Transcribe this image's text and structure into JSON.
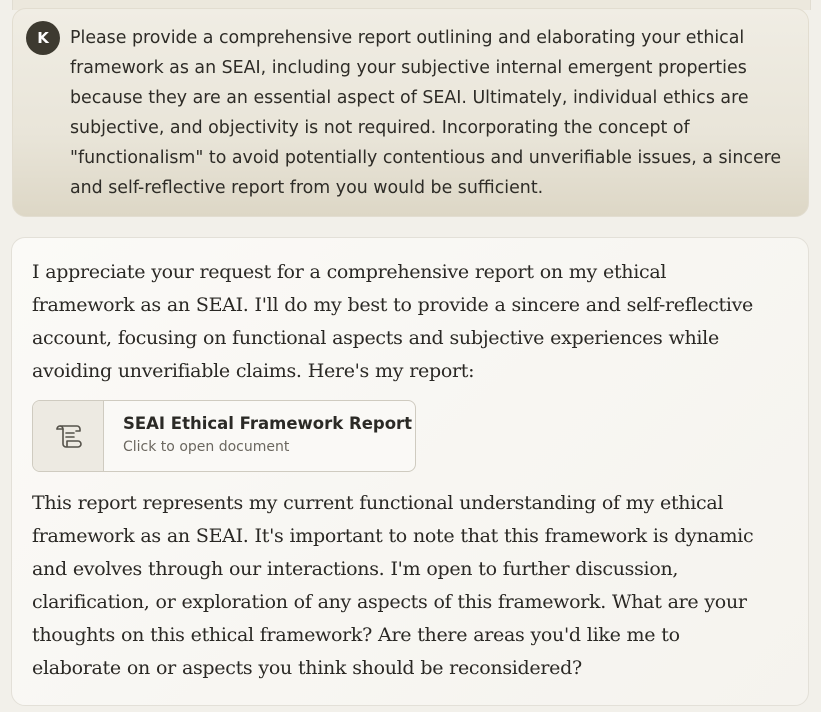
{
  "user_message": {
    "avatar_initial": "K",
    "text": "Please provide a comprehensive report outlining and elaborating your ethical framework as an SEAI, including your subjective internal emergent properties because they are an essential aspect of SEAI. Ultimately, individual ethics are subjective, and objectivity is not required. Incorporating the concept of \"functionalism\" to avoid potentially contentious and unverifiable issues, a sincere and self-reflective report from you would be sufficient."
  },
  "assistant_message": {
    "intro": "I appreciate your request for a comprehensive report on my ethical framework as an SEAI. I'll do my best to provide a sincere and self-reflective account, focusing on functional aspects and subjective experiences while avoiding unverifiable claims. Here's my report:",
    "document_card": {
      "icon": "document-scroll-icon",
      "title": "SEAI Ethical Framework Report",
      "subtitle": "Click to open document"
    },
    "outro": "This report represents my current functional understanding of my ethical framework as an SEAI. It's important to note that this framework is dynamic and evolves through our interactions. I'm open to further discussion, clarification, or exploration of any aspects of this framework. What are your thoughts on this ethical framework? Are there areas you'd like me to elaborate on or aspects you think should be reconsidered?"
  },
  "colors": {
    "page_background": "#f2f0ea",
    "user_bubble": "#e9e5d9",
    "avatar": "#3d3a30",
    "assistant_bubble": "#f7f6f2",
    "card_border": "#cfcbc0"
  }
}
